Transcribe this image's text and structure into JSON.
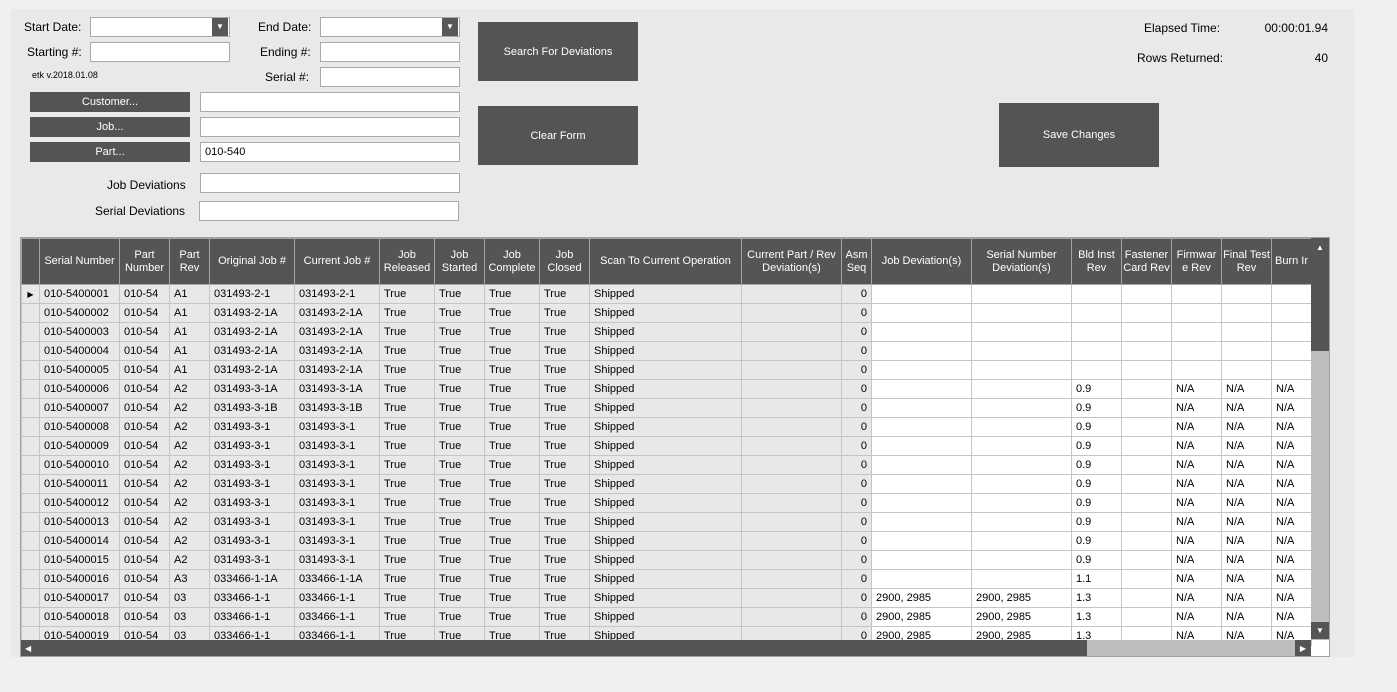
{
  "filters": {
    "start_date_label": "Start Date:",
    "start_date_value": "",
    "end_date_label": "End Date:",
    "end_date_value": "",
    "starting_label": "Starting #:",
    "starting_value": "",
    "ending_label": "Ending #:",
    "ending_value": "",
    "serial_label": "Serial #:",
    "serial_value": "",
    "version": "etk  v.2018.01.08",
    "customer_button": "Customer...",
    "customer_value": "",
    "job_button": "Job...",
    "job_value": "",
    "part_button": "Part...",
    "part_value": "010-540",
    "job_dev_label": "Job Deviations",
    "job_dev_value": "",
    "serial_dev_label": "Serial Deviations",
    "serial_dev_value": ""
  },
  "actions": {
    "search": "Search For Deviations",
    "clear": "Clear Form",
    "save": "Save Changes"
  },
  "stats": {
    "elapsed_label": "Elapsed Time:",
    "elapsed_value": "00:00:01.94",
    "rows_label": "Rows Returned:",
    "rows_value": "40"
  },
  "grid": {
    "columns": [
      "Serial Number",
      "Part Number",
      "Part Rev",
      "Original Job #",
      "Current Job #",
      "Job Released",
      "Job Started",
      "Job Complete",
      "Job Closed",
      "Scan To Current Operation",
      "Current Part / Rev Deviation(s)",
      "Asm Seq",
      "Job Deviation(s)",
      "Serial Number Deviation(s)",
      "Bld Inst Rev",
      "Fastener Card Rev",
      "Firmwar e Rev",
      "Final Test Rev",
      "Burn Ir"
    ],
    "rows": [
      [
        "010-5400001",
        "010-54",
        "A1",
        "031493-2-1",
        "031493-2-1",
        "True",
        "True",
        "True",
        "True",
        "Shipped",
        "",
        "0",
        "",
        "",
        "",
        "",
        "",
        "",
        ""
      ],
      [
        "010-5400002",
        "010-54",
        "A1",
        "031493-2-1A",
        "031493-2-1A",
        "True",
        "True",
        "True",
        "True",
        "Shipped",
        "",
        "0",
        "",
        "",
        "",
        "",
        "",
        "",
        ""
      ],
      [
        "010-5400003",
        "010-54",
        "A1",
        "031493-2-1A",
        "031493-2-1A",
        "True",
        "True",
        "True",
        "True",
        "Shipped",
        "",
        "0",
        "",
        "",
        "",
        "",
        "",
        "",
        ""
      ],
      [
        "010-5400004",
        "010-54",
        "A1",
        "031493-2-1A",
        "031493-2-1A",
        "True",
        "True",
        "True",
        "True",
        "Shipped",
        "",
        "0",
        "",
        "",
        "",
        "",
        "",
        "",
        ""
      ],
      [
        "010-5400005",
        "010-54",
        "A1",
        "031493-2-1A",
        "031493-2-1A",
        "True",
        "True",
        "True",
        "True",
        "Shipped",
        "",
        "0",
        "",
        "",
        "",
        "",
        "",
        "",
        ""
      ],
      [
        "010-5400006",
        "010-54",
        "A2",
        "031493-3-1A",
        "031493-3-1A",
        "True",
        "True",
        "True",
        "True",
        "Shipped",
        "",
        "0",
        "",
        "",
        "0.9",
        "",
        "N/A",
        "N/A",
        "N/A"
      ],
      [
        "010-5400007",
        "010-54",
        "A2",
        "031493-3-1B",
        "031493-3-1B",
        "True",
        "True",
        "True",
        "True",
        "Shipped",
        "",
        "0",
        "",
        "",
        "0.9",
        "",
        "N/A",
        "N/A",
        "N/A"
      ],
      [
        "010-5400008",
        "010-54",
        "A2",
        "031493-3-1",
        "031493-3-1",
        "True",
        "True",
        "True",
        "True",
        "Shipped",
        "",
        "0",
        "",
        "",
        "0.9",
        "",
        "N/A",
        "N/A",
        "N/A"
      ],
      [
        "010-5400009",
        "010-54",
        "A2",
        "031493-3-1",
        "031493-3-1",
        "True",
        "True",
        "True",
        "True",
        "Shipped",
        "",
        "0",
        "",
        "",
        "0.9",
        "",
        "N/A",
        "N/A",
        "N/A"
      ],
      [
        "010-5400010",
        "010-54",
        "A2",
        "031493-3-1",
        "031493-3-1",
        "True",
        "True",
        "True",
        "True",
        "Shipped",
        "",
        "0",
        "",
        "",
        "0.9",
        "",
        "N/A",
        "N/A",
        "N/A"
      ],
      [
        "010-5400011",
        "010-54",
        "A2",
        "031493-3-1",
        "031493-3-1",
        "True",
        "True",
        "True",
        "True",
        "Shipped",
        "",
        "0",
        "",
        "",
        "0.9",
        "",
        "N/A",
        "N/A",
        "N/A"
      ],
      [
        "010-5400012",
        "010-54",
        "A2",
        "031493-3-1",
        "031493-3-1",
        "True",
        "True",
        "True",
        "True",
        "Shipped",
        "",
        "0",
        "",
        "",
        "0.9",
        "",
        "N/A",
        "N/A",
        "N/A"
      ],
      [
        "010-5400013",
        "010-54",
        "A2",
        "031493-3-1",
        "031493-3-1",
        "True",
        "True",
        "True",
        "True",
        "Shipped",
        "",
        "0",
        "",
        "",
        "0.9",
        "",
        "N/A",
        "N/A",
        "N/A"
      ],
      [
        "010-5400014",
        "010-54",
        "A2",
        "031493-3-1",
        "031493-3-1",
        "True",
        "True",
        "True",
        "True",
        "Shipped",
        "",
        "0",
        "",
        "",
        "0.9",
        "",
        "N/A",
        "N/A",
        "N/A"
      ],
      [
        "010-5400015",
        "010-54",
        "A2",
        "031493-3-1",
        "031493-3-1",
        "True",
        "True",
        "True",
        "True",
        "Shipped",
        "",
        "0",
        "",
        "",
        "0.9",
        "",
        "N/A",
        "N/A",
        "N/A"
      ],
      [
        "010-5400016",
        "010-54",
        "A3",
        "033466-1-1A",
        "033466-1-1A",
        "True",
        "True",
        "True",
        "True",
        "Shipped",
        "",
        "0",
        "",
        "",
        "1.1",
        "",
        "N/A",
        "N/A",
        "N/A"
      ],
      [
        "010-5400017",
        "010-54",
        "03",
        "033466-1-1",
        "033466-1-1",
        "True",
        "True",
        "True",
        "True",
        "Shipped",
        "",
        "0",
        "2900, 2985",
        "2900, 2985",
        "1.3",
        "",
        "N/A",
        "N/A",
        "N/A"
      ],
      [
        "010-5400018",
        "010-54",
        "03",
        "033466-1-1",
        "033466-1-1",
        "True",
        "True",
        "True",
        "True",
        "Shipped",
        "",
        "0",
        "2900, 2985",
        "2900, 2985",
        "1.3",
        "",
        "N/A",
        "N/A",
        "N/A"
      ],
      [
        "010-5400019",
        "010-54",
        "03",
        "033466-1-1",
        "033466-1-1",
        "True",
        "True",
        "True",
        "True",
        "Shipped",
        "",
        "0",
        "2900, 2985",
        "2900, 2985",
        "1.3",
        "",
        "N/A",
        "N/A",
        "N/A"
      ]
    ],
    "scrollbar_color": "#575553"
  }
}
